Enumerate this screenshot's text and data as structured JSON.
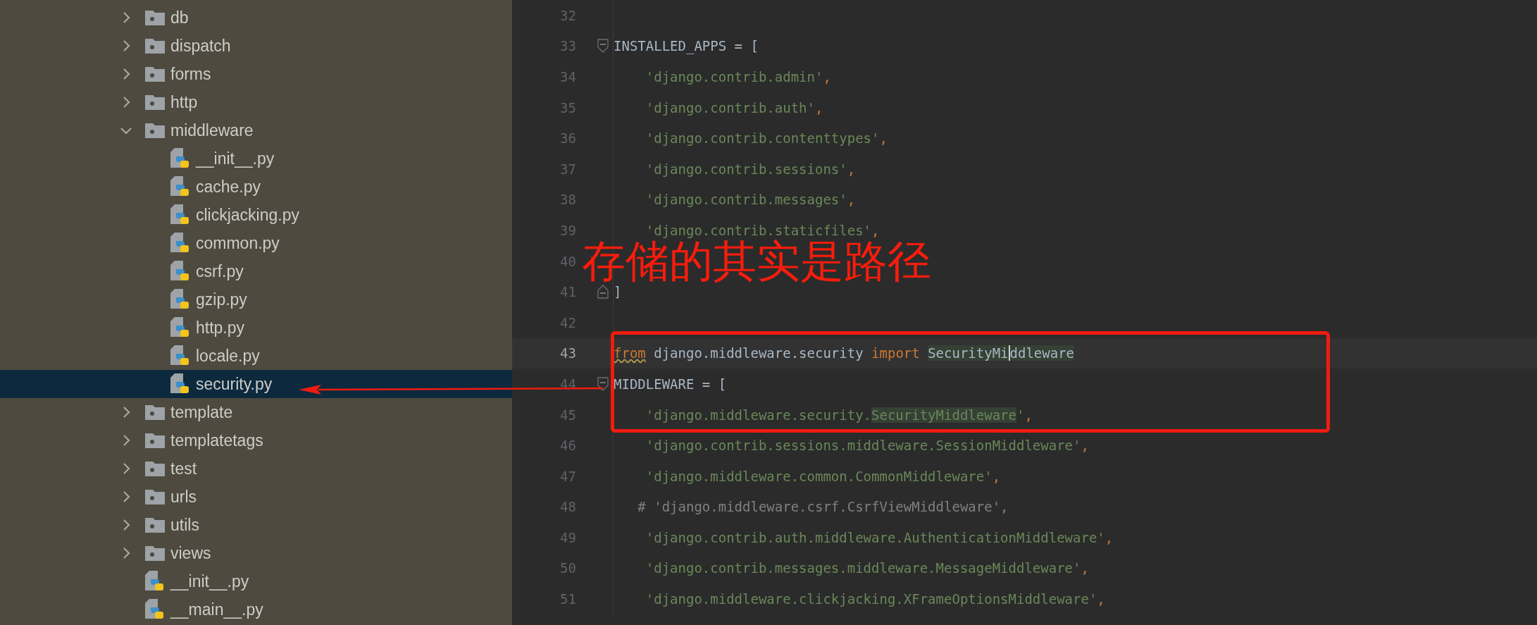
{
  "tree": [
    {
      "name": "db",
      "kind": "folder",
      "expanded": false,
      "selected": false
    },
    {
      "name": "dispatch",
      "kind": "folder",
      "expanded": false,
      "selected": false
    },
    {
      "name": "forms",
      "kind": "folder",
      "expanded": false,
      "selected": false
    },
    {
      "name": "http",
      "kind": "folder",
      "expanded": false,
      "selected": false
    },
    {
      "name": "middleware",
      "kind": "folder",
      "expanded": true,
      "selected": false,
      "children": [
        {
          "name": "__init__.py",
          "kind": "pyfile",
          "selected": false
        },
        {
          "name": "cache.py",
          "kind": "pyfile",
          "selected": false
        },
        {
          "name": "clickjacking.py",
          "kind": "pyfile",
          "selected": false
        },
        {
          "name": "common.py",
          "kind": "pyfile",
          "selected": false
        },
        {
          "name": "csrf.py",
          "kind": "pyfile",
          "selected": false
        },
        {
          "name": "gzip.py",
          "kind": "pyfile",
          "selected": false
        },
        {
          "name": "http.py",
          "kind": "pyfile",
          "selected": false
        },
        {
          "name": "locale.py",
          "kind": "pyfile",
          "selected": false
        },
        {
          "name": "security.py",
          "kind": "pyfile",
          "selected": true
        }
      ]
    },
    {
      "name": "template",
      "kind": "folder",
      "expanded": false,
      "selected": false
    },
    {
      "name": "templatetags",
      "kind": "folder",
      "expanded": false,
      "selected": false
    },
    {
      "name": "test",
      "kind": "folder",
      "expanded": false,
      "selected": false
    },
    {
      "name": "urls",
      "kind": "folder",
      "expanded": false,
      "selected": false
    },
    {
      "name": "utils",
      "kind": "folder",
      "expanded": false,
      "selected": false
    },
    {
      "name": "views",
      "kind": "folder",
      "expanded": false,
      "selected": false
    },
    {
      "name": "__init__.py",
      "kind": "pyfile",
      "selected": false
    },
    {
      "name": "__main__.py",
      "kind": "pyfile",
      "selected": false
    }
  ],
  "editor": {
    "lines": [
      {
        "number": "32",
        "current": false
      },
      {
        "number": "33",
        "current": false,
        "fold_start": true,
        "tokens": [
          {
            "t": "INSTALLED_APPS = [",
            "kind": "plain"
          }
        ]
      },
      {
        "number": "34",
        "current": false,
        "tokens": [
          {
            "t": "    'django.contrib.admin'",
            "kind": "str"
          },
          {
            "t": ",",
            "kind": "comma"
          }
        ]
      },
      {
        "number": "35",
        "current": false,
        "tokens": [
          {
            "t": "    'django.contrib.auth'",
            "kind": "str"
          },
          {
            "t": ",",
            "kind": "comma"
          }
        ]
      },
      {
        "number": "36",
        "current": false,
        "tokens": [
          {
            "t": "    'django.contrib.contenttypes'",
            "kind": "str"
          },
          {
            "t": ",",
            "kind": "comma"
          }
        ]
      },
      {
        "number": "37",
        "current": false,
        "tokens": [
          {
            "t": "    'django.contrib.sessions'",
            "kind": "str"
          },
          {
            "t": ",",
            "kind": "comma"
          }
        ]
      },
      {
        "number": "38",
        "current": false,
        "tokens": [
          {
            "t": "    'django.contrib.messages'",
            "kind": "str"
          },
          {
            "t": ",",
            "kind": "comma"
          }
        ]
      },
      {
        "number": "39",
        "current": false,
        "tokens": [
          {
            "t": "    'django.contrib.staticfiles'",
            "kind": "str"
          },
          {
            "t": ",",
            "kind": "comma"
          }
        ]
      },
      {
        "number": "40",
        "current": false
      },
      {
        "number": "41",
        "current": false,
        "fold_end": true,
        "tokens": [
          {
            "t": "]",
            "kind": "plain"
          }
        ]
      },
      {
        "number": "42",
        "current": false
      },
      {
        "number": "43",
        "current": true,
        "tokens": [
          {
            "t": "from",
            "kind": "warnkw"
          },
          {
            "t": " django.middleware.security ",
            "kind": "plain"
          },
          {
            "t": "import ",
            "kind": "kw"
          },
          {
            "t": "SecurityMi",
            "kind": "match",
            "caret": true
          },
          {
            "t": "ddleware",
            "kind": "match",
            "caret": false
          }
        ]
      },
      {
        "number": "44",
        "current": false,
        "fold_start": true,
        "tokens": [
          {
            "t": "MIDDLEWARE = [",
            "kind": "plain"
          }
        ]
      },
      {
        "number": "45",
        "current": false,
        "tokens": [
          {
            "t": "    'django.middleware.security.",
            "kind": "str"
          },
          {
            "t": "SecurityMiddleware",
            "kind": "strmatch"
          },
          {
            "t": "'",
            "kind": "str"
          },
          {
            "t": ",",
            "kind": "comma"
          }
        ]
      },
      {
        "number": "46",
        "current": false,
        "tokens": [
          {
            "t": "    'django.contrib.sessions.middleware.SessionMiddleware'",
            "kind": "str"
          },
          {
            "t": ",",
            "kind": "comma"
          }
        ]
      },
      {
        "number": "47",
        "current": false,
        "tokens": [
          {
            "t": "    'django.middleware.common.CommonMiddleware'",
            "kind": "str"
          },
          {
            "t": ",",
            "kind": "comma"
          }
        ]
      },
      {
        "number": "48",
        "current": false,
        "tokens": [
          {
            "t": "   # 'django.middleware.csrf.CsrfViewMiddleware',",
            "kind": "comment"
          }
        ]
      },
      {
        "number": "49",
        "current": false,
        "tokens": [
          {
            "t": "    'django.contrib.auth.middleware.AuthenticationMiddleware'",
            "kind": "str"
          },
          {
            "t": ",",
            "kind": "comma"
          }
        ]
      },
      {
        "number": "50",
        "current": false,
        "tokens": [
          {
            "t": "    'django.contrib.messages.middleware.MessageMiddleware'",
            "kind": "str"
          },
          {
            "t": ",",
            "kind": "comma"
          }
        ]
      },
      {
        "number": "51",
        "current": false,
        "tokens": [
          {
            "t": "    'django.middleware.clickjacking.XFrameOptionsMiddleware'",
            "kind": "str"
          },
          {
            "t": ",",
            "kind": "comma"
          }
        ]
      }
    ]
  },
  "annotation": {
    "text": "存储的其实是路径"
  }
}
